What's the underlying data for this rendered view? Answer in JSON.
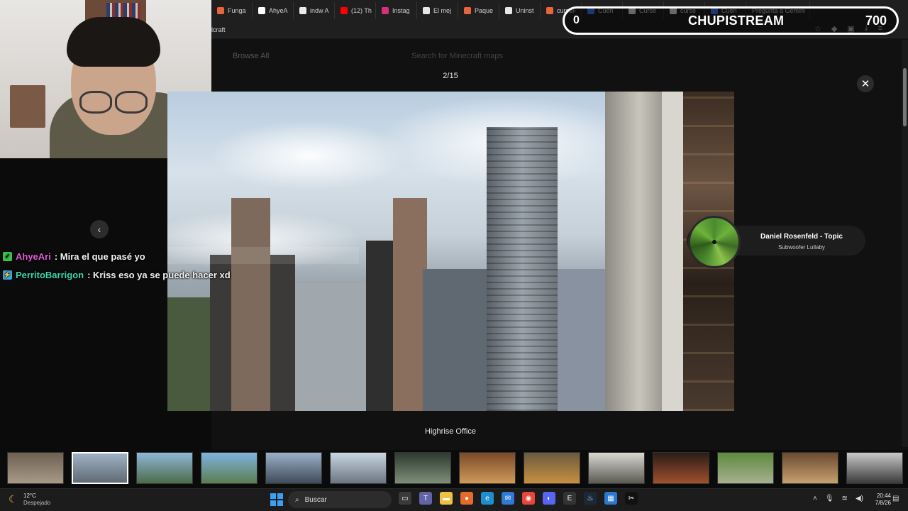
{
  "browser": {
    "tabs": [
      {
        "label": "Funga",
        "color": "#e8643a"
      },
      {
        "label": "AhyeA",
        "color": "#ffffff"
      },
      {
        "label": "indw A",
        "color": "#eaeaea"
      },
      {
        "label": "(12) Th",
        "color": "#ff0000"
      },
      {
        "label": "Instag",
        "color": "#d6307a"
      },
      {
        "label": "El mej",
        "color": "#e6e6e6"
      },
      {
        "label": "Paque",
        "color": "#e8643a"
      },
      {
        "label": "Uninst",
        "color": "#e6e6e6"
      },
      {
        "label": "curseF",
        "color": "#e8643a"
      },
      {
        "label": "Cuen",
        "color": "#3b82f6"
      },
      {
        "label": "Curse",
        "color": "#e6e6e6"
      },
      {
        "label": "curse",
        "color": "#e6e6e6"
      },
      {
        "label": "Cuen",
        "color": "#3b82f6"
      }
    ],
    "gemini_label": "Pregunta a Gemini",
    "bookmark_text": "lcraft"
  },
  "overlay": {
    "left_count": "0",
    "title": "CHUPISTREAM",
    "right_count": "700"
  },
  "page": {
    "browse_label": "Browse All",
    "search_placeholder": "Search for Minecraft maps"
  },
  "viewer": {
    "counter": "2/15",
    "close_label": "✕",
    "prev_label": "‹",
    "caption": "Highrise Office"
  },
  "chat": [
    {
      "user": "AhyeAri",
      "text": ": Mira el que pasé yo",
      "badge": "green",
      "user_color": "pink",
      "badge_glyph": "✓"
    },
    {
      "user": "PerritoBarrigon",
      "text": ": Kriss eso ya se puede hacer xd",
      "badge": "blue",
      "user_color": "teal",
      "badge_glyph": "⚡"
    }
  ],
  "music": {
    "artist": "Daniel Rosenfeld - Topic",
    "track": "Subwoofer Lullaby"
  },
  "thumbnails": [
    {
      "active": false,
      "colors": [
        "#6e6152",
        "#a79a87"
      ]
    },
    {
      "active": true,
      "colors": [
        "#9fb2c4",
        "#5f6a74"
      ]
    },
    {
      "active": false,
      "colors": [
        "#8fb7d8",
        "#4b6b48"
      ]
    },
    {
      "active": false,
      "colors": [
        "#7fb3e0",
        "#5b7d50"
      ]
    },
    {
      "active": false,
      "colors": [
        "#9ab0c8",
        "#3f4a58"
      ]
    },
    {
      "active": false,
      "colors": [
        "#c8d6e2",
        "#6b7580"
      ]
    },
    {
      "active": false,
      "colors": [
        "#2d3a30",
        "#7e8f78"
      ]
    },
    {
      "active": false,
      "colors": [
        "#7a4a28",
        "#d09a5a"
      ]
    },
    {
      "active": false,
      "colors": [
        "#6a5a40",
        "#c89040"
      ]
    },
    {
      "active": false,
      "colors": [
        "#d8d8d0",
        "#5a5a52"
      ]
    },
    {
      "active": false,
      "colors": [
        "#2a1c16",
        "#a0502e"
      ]
    },
    {
      "active": false,
      "colors": [
        "#5c8a3e",
        "#a8b090"
      ]
    },
    {
      "active": false,
      "colors": [
        "#6a4a30",
        "#c8a070"
      ]
    },
    {
      "active": false,
      "colors": [
        "#c8c8c8",
        "#3a3a3a"
      ]
    }
  ],
  "taskbar": {
    "temperature": "12°C",
    "weather": "Despejado",
    "search_label": "Buscar",
    "time": "20:44",
    "date": "7/8/26",
    "apps": [
      {
        "name": "file-manager-icon",
        "color": "#3a3a3a",
        "glyph": "▭"
      },
      {
        "name": "teams-icon",
        "color": "#6264a7",
        "glyph": "T"
      },
      {
        "name": "folder-icon",
        "color": "#f0c040",
        "glyph": "▬"
      },
      {
        "name": "firefox-icon",
        "color": "#e66a2c",
        "glyph": "●"
      },
      {
        "name": "edge-icon",
        "color": "#1d8fcf",
        "glyph": "e"
      },
      {
        "name": "mail-icon",
        "color": "#2e7ad6",
        "glyph": "✉"
      },
      {
        "name": "chrome-icon",
        "color": "#e8453c",
        "glyph": "◉"
      },
      {
        "name": "discord-icon",
        "color": "#5865f2",
        "glyph": "◐"
      },
      {
        "name": "epic-games-icon",
        "color": "#333333",
        "glyph": "E"
      },
      {
        "name": "steam-icon",
        "color": "#1b2838",
        "glyph": "♨"
      },
      {
        "name": "store-icon",
        "color": "#2b78d0",
        "glyph": "▦"
      },
      {
        "name": "capcut-icon",
        "color": "#111111",
        "glyph": "✂"
      }
    ]
  }
}
